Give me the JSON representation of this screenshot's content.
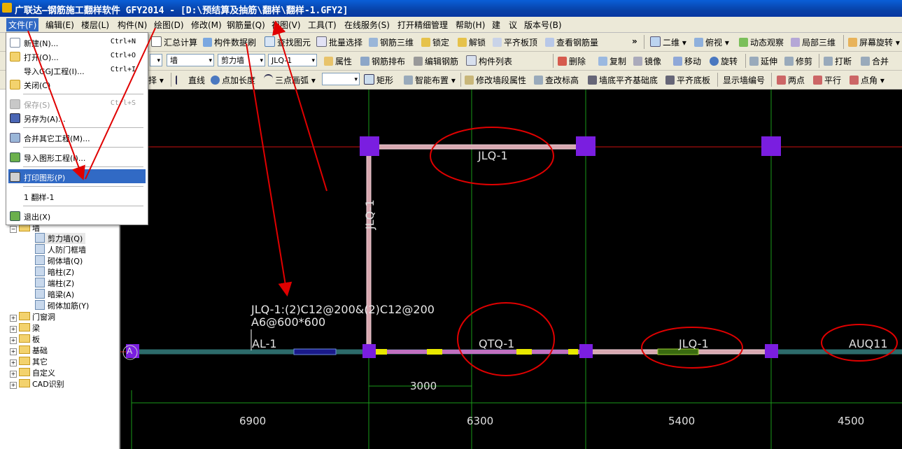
{
  "window": {
    "title": "广联达—钢筋施工翻样软件 GFY2014 - [D:\\预结算及抽筋\\翻样\\翻样-1.GFY2]"
  },
  "menubar": [
    {
      "label": "文件(F)"
    },
    {
      "label": "编辑(E)"
    },
    {
      "label": "楼层(L)"
    },
    {
      "label": "构件(N)"
    },
    {
      "label": "绘图(D)"
    },
    {
      "label": "修改(M)"
    },
    {
      "label": "钢筋量(Q)"
    },
    {
      "label": "视图(V)"
    },
    {
      "label": "工具(T)"
    },
    {
      "label": "在线服务(S)"
    },
    {
      "label": "打开精细管理"
    },
    {
      "label": "帮助(H)"
    },
    {
      "label": "建"
    },
    {
      "label": "议"
    },
    {
      "label": "版本号(B)"
    }
  ],
  "toolbar1": [
    {
      "label": "汇总计算"
    },
    {
      "label": "构件数据刷"
    },
    {
      "label": "查找图元"
    },
    {
      "label": "批量选择"
    },
    {
      "label": "钢筋三维"
    },
    {
      "label": "锁定"
    },
    {
      "label": "解锁"
    },
    {
      "label": "平齐板顶"
    },
    {
      "label": "查看钢筋量"
    },
    {
      "label": "»"
    },
    {
      "label": "二维"
    },
    {
      "label": "俯视"
    },
    {
      "label": "动态观察"
    },
    {
      "label": "局部三维"
    },
    {
      "label": "屏幕旋转"
    }
  ],
  "toolbar2": {
    "combos": [
      {
        "value": "墙"
      },
      {
        "value": "剪力墙"
      },
      {
        "value": "JLQ-1"
      }
    ],
    "buttons": [
      {
        "label": "属性"
      },
      {
        "label": "钢筋排布"
      },
      {
        "label": "编辑钢筋"
      },
      {
        "label": "构件列表"
      },
      {
        "label": "删除"
      },
      {
        "label": "复制"
      },
      {
        "label": "镜像"
      },
      {
        "label": "移动"
      },
      {
        "label": "旋转"
      },
      {
        "label": "延伸"
      },
      {
        "label": "修剪"
      },
      {
        "label": "打断"
      },
      {
        "label": "合并"
      }
    ]
  },
  "toolbar3": [
    {
      "label": "择"
    },
    {
      "label": "直线"
    },
    {
      "label": "点加长度"
    },
    {
      "label": "三点画弧"
    },
    {
      "label": "矩形"
    },
    {
      "label": "智能布置"
    },
    {
      "label": "修改墙段属性"
    },
    {
      "label": "查改标高"
    },
    {
      "label": "墙底平齐基础底"
    },
    {
      "label": "平齐底板"
    },
    {
      "label": "显示墙编号"
    },
    {
      "label": "两点"
    },
    {
      "label": "平行"
    },
    {
      "label": "点角"
    }
  ],
  "file_menu": {
    "items": [
      {
        "label": "新建(N)...",
        "shortcut": "Ctrl+N",
        "state": "normal"
      },
      {
        "label": "打开(O)...",
        "shortcut": "Ctrl+O",
        "state": "normal"
      },
      {
        "label": "导入GGJ工程(I)...",
        "shortcut": "Ctrl+I",
        "state": "normal"
      },
      {
        "label": "关闭(C)",
        "shortcut": "",
        "state": "normal"
      },
      {
        "label": "保存(S)",
        "shortcut": "Ctrl+S",
        "state": "disabled"
      },
      {
        "label": "另存为(A)...",
        "shortcut": "",
        "state": "normal"
      },
      {
        "label": "合并其它工程(M)...",
        "shortcut": "",
        "state": "normal"
      },
      {
        "label": "导入图形工程(I)...",
        "shortcut": "",
        "state": "normal"
      },
      {
        "label": "打印图形(P)",
        "shortcut": "",
        "state": "highlighted"
      },
      {
        "label": "1 翻样-1",
        "shortcut": "",
        "state": "normal"
      },
      {
        "label": "退出(X)",
        "shortcut": "",
        "state": "normal"
      }
    ]
  },
  "tree": {
    "wall_group": "墙",
    "wall_children": [
      {
        "label": "剪力墙(Q)"
      },
      {
        "label": "人防门框墙"
      },
      {
        "label": "砌体墙(Q)"
      },
      {
        "label": "暗柱(Z)"
      },
      {
        "label": "端柱(Z)"
      },
      {
        "label": "暗梁(A)"
      },
      {
        "label": "砌体加筋(Y)"
      }
    ],
    "other_groups": [
      {
        "label": "门窗洞"
      },
      {
        "label": "梁"
      },
      {
        "label": "板"
      },
      {
        "label": "基础"
      },
      {
        "label": "其它"
      },
      {
        "label": "自定义"
      },
      {
        "label": "CAD识别"
      }
    ]
  },
  "drawing": {
    "wall_label_top": "JLQ-1",
    "wall_label_vertical": "JLQ-1",
    "rebar_line1": "JLQ-1:(2)C12@200&(2)C12@200",
    "rebar_line2": "A6@600*600",
    "beam_label": "AL-1",
    "wall_label_qtq": "QTQ-1",
    "wall_label_right": "JLQ-1",
    "wall_label_far": "AUQ11",
    "axis_label": "A",
    "dim_small": "3000",
    "dims": [
      "6900",
      "6300",
      "5400",
      "4500"
    ]
  },
  "colors": {
    "titlebar": "#0842a8",
    "menu_highlight": "#316ac5",
    "annotation_red": "#e00000",
    "column_purple": "#7a1ee0",
    "grid_red": "#cc1111",
    "grid_green": "#1a9a1a"
  }
}
